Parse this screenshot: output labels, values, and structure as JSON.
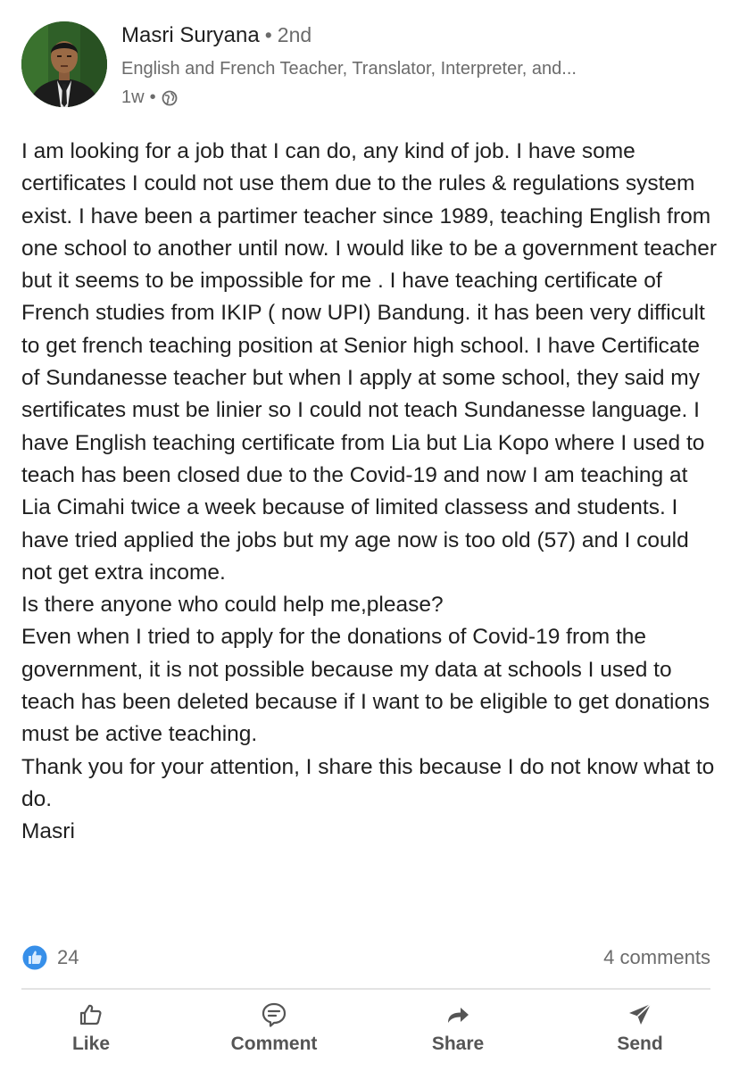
{
  "post": {
    "author": {
      "name": "Masri Suryana",
      "connection_separator": "•",
      "connection_degree": "2nd",
      "headline": "English and French Teacher, Translator, Interpreter, and...",
      "time_ago": "1w",
      "meta_separator": "•",
      "visibility_icon": "globe-icon"
    },
    "body": {
      "paragraphs": [
        "I am looking for a job that I can do, any kind of job. I have some certificates I could not use them due to the rules & regulations system exist. I have been a partimer teacher since 1989, teaching English from one school to another until now. I would like to be a government teacher but it seems to be impossible for me . I have teaching certificate of French studies  from IKIP ( now UPI) Bandung. it has been very difficult to get french teaching position at Senior high school. I have Certificate of Sundanesse teacher but when I apply at some school, they said my sertificates must be linier so I could not teach Sundanesse language. I have English teaching certificate from Lia but Lia Kopo where I used to teach has been closed due to the Covid-19 and now I am teaching at Lia Cimahi twice a week because of limited classess and students. I have tried applied the jobs but my age now is too old (57) and I could not get extra income.",
        "Is there anyone who could help me,please?",
        "Even when I tried to apply for the donations of Covid-19 from the government, it is not possible because my data at schools I used to teach has been deleted because if I want to be eligible to get donations must be active teaching.",
        "Thank you for your attention, I share this because I do not know what to do.",
        "Masri"
      ]
    },
    "social": {
      "reaction_icon": "like-reaction-icon",
      "reaction_count": "24",
      "comments_label": "4 comments"
    }
  },
  "actions": [
    {
      "label": "Like",
      "icon": "thumbs-up-icon"
    },
    {
      "label": "Comment",
      "icon": "comment-icon"
    },
    {
      "label": "Share",
      "icon": "share-arrow-icon"
    },
    {
      "label": "Send",
      "icon": "send-icon"
    }
  ],
  "colors": {
    "text_primary": "#1f1f1f",
    "text_secondary": "#6b6b6b",
    "like_blue": "#378fe9",
    "divider": "#e3e3e3"
  }
}
